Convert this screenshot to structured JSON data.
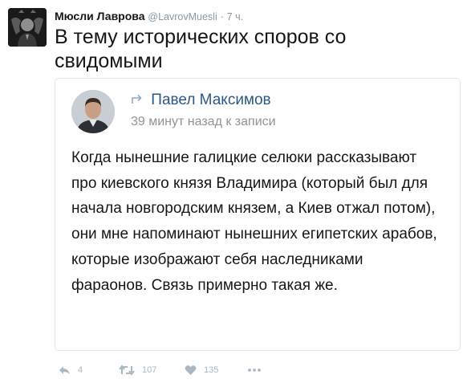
{
  "tweet": {
    "author_name": "Мюсли Лаврова",
    "author_handle": "@LavrovMuesli",
    "separator": "·",
    "time": "7 ч.",
    "text": "В тему исторических споров со свидомыми"
  },
  "quoted_post": {
    "author_name": "Павел Максимов",
    "meta": "39 минут назад к записи",
    "text": "Когда нынешние галицкие селюки рассказывают про киевского князя Владимира (который был для начала новгородским князем, а Киев отжал потом), они мне напоминают нынешних египетских арабов, которые изображают себя наследниками фараонов. Связь примерно такая же."
  },
  "actions": {
    "reply_count": "4",
    "retweet_count": "107",
    "like_count": "135"
  },
  "colors": {
    "link": "#2a5885",
    "muted": "#8899a6",
    "icon": "#aab8c2"
  }
}
